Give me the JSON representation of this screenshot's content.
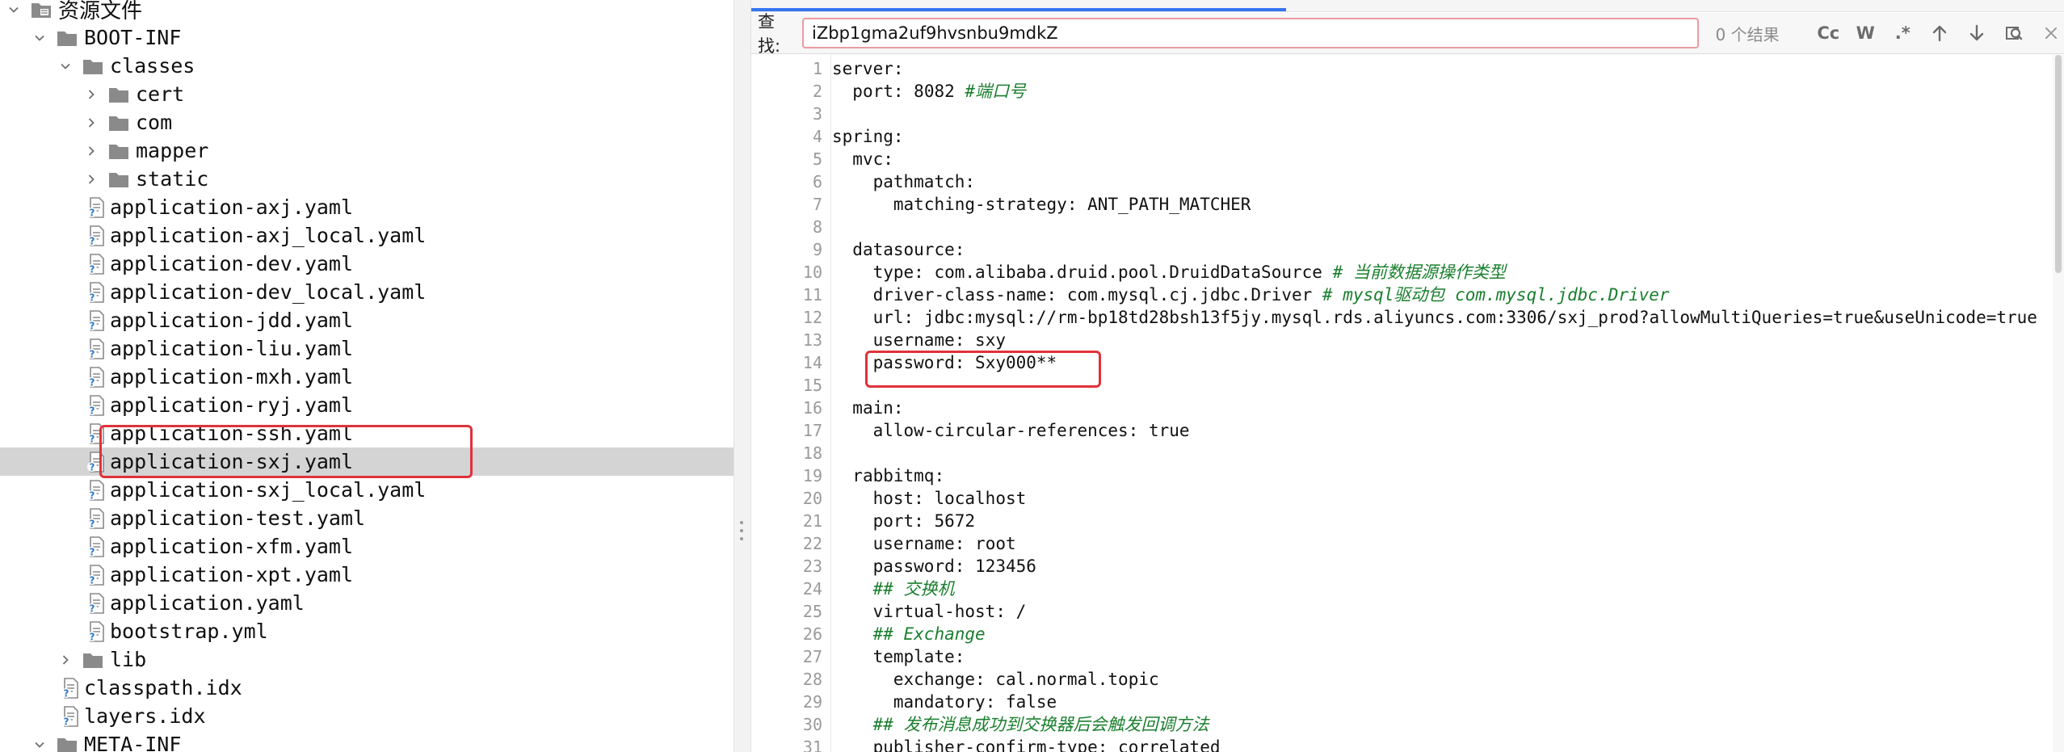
{
  "tree": {
    "items": [
      {
        "label": "资源文件",
        "icon": "resource-folder-icon",
        "expanded": true,
        "type": "folder"
      },
      {
        "label": "BOOT-INF",
        "icon": "folder-icon",
        "expanded": true,
        "type": "folder"
      },
      {
        "label": "classes",
        "icon": "folder-icon",
        "expanded": true,
        "type": "folder"
      },
      {
        "label": "cert",
        "icon": "folder-icon",
        "expanded": false,
        "type": "folder"
      },
      {
        "label": "com",
        "icon": "folder-icon",
        "expanded": false,
        "type": "folder"
      },
      {
        "label": "mapper",
        "icon": "folder-icon",
        "expanded": false,
        "type": "folder"
      },
      {
        "label": "static",
        "icon": "folder-icon",
        "expanded": false,
        "type": "folder"
      },
      {
        "label": "application-axj.yaml",
        "icon": "yaml-file-icon",
        "type": "file"
      },
      {
        "label": "application-axj_local.yaml",
        "icon": "yaml-file-icon",
        "type": "file"
      },
      {
        "label": "application-dev.yaml",
        "icon": "yaml-file-icon",
        "type": "file"
      },
      {
        "label": "application-dev_local.yaml",
        "icon": "yaml-file-icon",
        "type": "file"
      },
      {
        "label": "application-jdd.yaml",
        "icon": "yaml-file-icon",
        "type": "file"
      },
      {
        "label": "application-liu.yaml",
        "icon": "yaml-file-icon",
        "type": "file"
      },
      {
        "label": "application-mxh.yaml",
        "icon": "yaml-file-icon",
        "type": "file"
      },
      {
        "label": "application-ryj.yaml",
        "icon": "yaml-file-icon",
        "type": "file"
      },
      {
        "label": "application-ssh.yaml",
        "icon": "yaml-file-icon",
        "type": "file"
      },
      {
        "label": "application-sxj.yaml",
        "icon": "yaml-file-icon",
        "type": "file",
        "selected": true
      },
      {
        "label": "application-sxj_local.yaml",
        "icon": "yaml-file-icon",
        "type": "file"
      },
      {
        "label": "application-test.yaml",
        "icon": "yaml-file-icon",
        "type": "file"
      },
      {
        "label": "application-xfm.yaml",
        "icon": "yaml-file-icon",
        "type": "file"
      },
      {
        "label": "application-xpt.yaml",
        "icon": "yaml-file-icon",
        "type": "file"
      },
      {
        "label": "application.yaml",
        "icon": "yaml-file-icon",
        "type": "file"
      },
      {
        "label": "bootstrap.yml",
        "icon": "yaml-file-icon",
        "type": "file"
      },
      {
        "label": "lib",
        "icon": "folder-icon",
        "expanded": false,
        "type": "folder"
      },
      {
        "label": "classpath.idx",
        "icon": "idx-file-icon",
        "type": "file"
      },
      {
        "label": "layers.idx",
        "icon": "idx-file-icon",
        "type": "file"
      },
      {
        "label": "META-INF",
        "icon": "folder-icon",
        "expanded": true,
        "type": "folder"
      }
    ]
  },
  "find": {
    "label": "查找:",
    "query": "iZbp1gma2uf9hvsnbu9mdkZ",
    "result": "0 个结果",
    "match_case": "Cc",
    "whole_word": "W",
    "regex": ".*"
  },
  "editor": {
    "lines": [
      {
        "n": "1",
        "indent": 0,
        "key": "server",
        "value": "",
        "comment": ""
      },
      {
        "n": "2",
        "indent": 1,
        "key": "port",
        "value": "8082",
        "comment": "#端口号"
      },
      {
        "n": "3",
        "indent": 0,
        "key": "",
        "value": "",
        "comment": ""
      },
      {
        "n": "4",
        "indent": 0,
        "key": "spring",
        "value": "",
        "comment": ""
      },
      {
        "n": "5",
        "indent": 1,
        "key": "mvc",
        "value": "",
        "comment": ""
      },
      {
        "n": "6",
        "indent": 2,
        "key": "pathmatch",
        "value": "",
        "comment": ""
      },
      {
        "n": "7",
        "indent": 3,
        "key": "matching-strategy",
        "value": "ANT_PATH_MATCHER",
        "comment": ""
      },
      {
        "n": "8",
        "indent": 0,
        "key": "",
        "value": "",
        "comment": ""
      },
      {
        "n": "9",
        "indent": 1,
        "key": "datasource",
        "value": "",
        "comment": ""
      },
      {
        "n": "10",
        "indent": 2,
        "key": "type",
        "value": "com.alibaba.druid.pool.DruidDataSource",
        "comment": "# 当前数据源操作类型"
      },
      {
        "n": "11",
        "indent": 2,
        "key": "driver-class-name",
        "value": "com.mysql.cj.jdbc.Driver",
        "comment": "# mysql驱动包 com.mysql.jdbc.Driver"
      },
      {
        "n": "12",
        "indent": 2,
        "key": "url",
        "value": "jdbc:mysql://rm-bp18td28bsh13f5jy.mysql.rds.aliyuncs.com:3306/sxj_prod?allowMultiQueries=true&useUnicode=true",
        "comment": ""
      },
      {
        "n": "13",
        "indent": 2,
        "key": "username",
        "value": "sxy",
        "comment": ""
      },
      {
        "n": "14",
        "indent": 2,
        "key": "password",
        "value": "Sxy000**",
        "comment": ""
      },
      {
        "n": "15",
        "indent": 0,
        "key": "",
        "value": "",
        "comment": ""
      },
      {
        "n": "16",
        "indent": 1,
        "key": "main",
        "value": "",
        "comment": ""
      },
      {
        "n": "17",
        "indent": 2,
        "key": "allow-circular-references",
        "value": "true",
        "comment": ""
      },
      {
        "n": "18",
        "indent": 0,
        "key": "",
        "value": "",
        "comment": ""
      },
      {
        "n": "19",
        "indent": 1,
        "key": "rabbitmq",
        "value": "",
        "comment": ""
      },
      {
        "n": "20",
        "indent": 2,
        "key": "host",
        "value": "localhost",
        "comment": ""
      },
      {
        "n": "21",
        "indent": 2,
        "key": "port",
        "value": "5672",
        "comment": ""
      },
      {
        "n": "22",
        "indent": 2,
        "key": "username",
        "value": "root",
        "comment": ""
      },
      {
        "n": "23",
        "indent": 2,
        "key": "password",
        "value": "123456",
        "comment": ""
      },
      {
        "n": "24",
        "indent": 2,
        "key": "",
        "value": "",
        "comment": "## 交换机"
      },
      {
        "n": "25",
        "indent": 2,
        "key": "virtual-host",
        "value": "/",
        "comment": ""
      },
      {
        "n": "26",
        "indent": 2,
        "key": "",
        "value": "",
        "comment": "## Exchange"
      },
      {
        "n": "27",
        "indent": 2,
        "key": "template",
        "value": "",
        "comment": ""
      },
      {
        "n": "28",
        "indent": 3,
        "key": "exchange",
        "value": "cal.normal.topic",
        "comment": ""
      },
      {
        "n": "29",
        "indent": 3,
        "key": "mandatory",
        "value": "false",
        "comment": ""
      },
      {
        "n": "30",
        "indent": 2,
        "key": "",
        "value": "",
        "comment": "## 发布消息成功到交换器后会触发回调方法"
      },
      {
        "n": "31",
        "indent": 2,
        "key": "publisher-confirm-type",
        "value": "correlated",
        "comment": ""
      }
    ]
  },
  "colors": {
    "highlight_box": "#e0323a",
    "comment": "#1a7f2e",
    "selection": "#d4d4d4",
    "tab_indicator": "#3574f0",
    "find_input_border": "#ec9aa0"
  }
}
